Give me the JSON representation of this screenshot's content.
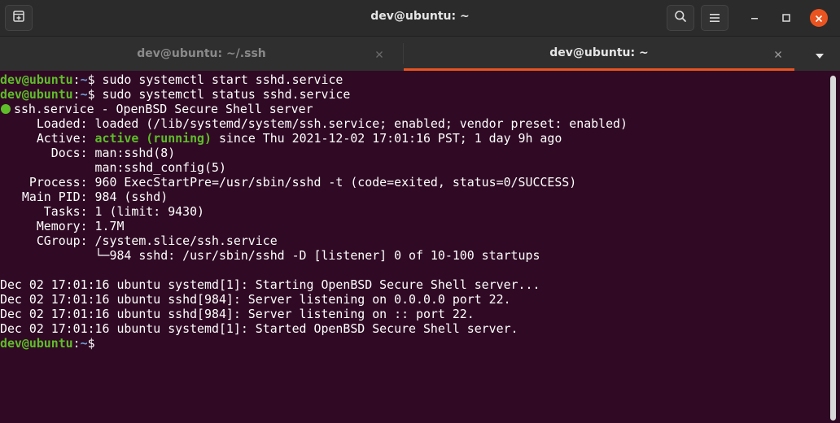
{
  "window": {
    "title": "dev@ubuntu: ~"
  },
  "icons": {
    "new_tab": "new-tab-icon",
    "search": "search-icon",
    "menu": "hamburger-menu-icon",
    "minimize": "minimize-icon",
    "maximize": "maximize-icon",
    "close": "close-icon",
    "tab_close": "tab-close-icon",
    "tabs_menu": "chevron-down-icon"
  },
  "colors": {
    "terminal_bg": "#300a24",
    "prompt_user": "#5fbd2a",
    "prompt_path": "#6e9fd8",
    "accent": "#e95420"
  },
  "tabs": [
    {
      "label": "dev@ubuntu: ~/.ssh",
      "active": false
    },
    {
      "label": "dev@ubuntu: ~",
      "active": true
    }
  ],
  "terminal": {
    "prompt_user": "dev@ubuntu",
    "prompt_sep": ":",
    "prompt_path": "~",
    "prompt_symbol": "$",
    "cmd1": " sudo systemctl start sshd.service",
    "cmd2": " sudo systemctl status sshd.service",
    "status_header": "ssh.service - OpenBSD Secure Shell server",
    "loaded": "     Loaded: loaded (/lib/systemd/system/ssh.service; enabled; vendor preset: enabled)",
    "active_label": "     Active: ",
    "active_state": "active (running)",
    "active_since": " since Thu 2021-12-02 17:01:16 PST; 1 day 9h ago",
    "docs1": "       Docs: man:sshd(8)",
    "docs2": "             man:sshd_config(5)",
    "process": "    Process: 960 ExecStartPre=/usr/sbin/sshd -t (code=exited, status=0/SUCCESS)",
    "main_pid": "   Main PID: 984 (sshd)",
    "tasks": "      Tasks: 1 (limit: 9430)",
    "memory": "     Memory: 1.7M",
    "cgroup": "     CGroup: /system.slice/ssh.service",
    "cgroup_child": "             └─984 sshd: /usr/sbin/sshd -D [listener] 0 of 10-100 startups",
    "log": [
      "Dec 02 17:01:16 ubuntu systemd[1]: Starting OpenBSD Secure Shell server...",
      "Dec 02 17:01:16 ubuntu sshd[984]: Server listening on 0.0.0.0 port 22.",
      "Dec 02 17:01:16 ubuntu sshd[984]: Server listening on :: port 22.",
      "Dec 02 17:01:16 ubuntu systemd[1]: Started OpenBSD Secure Shell server."
    ]
  }
}
